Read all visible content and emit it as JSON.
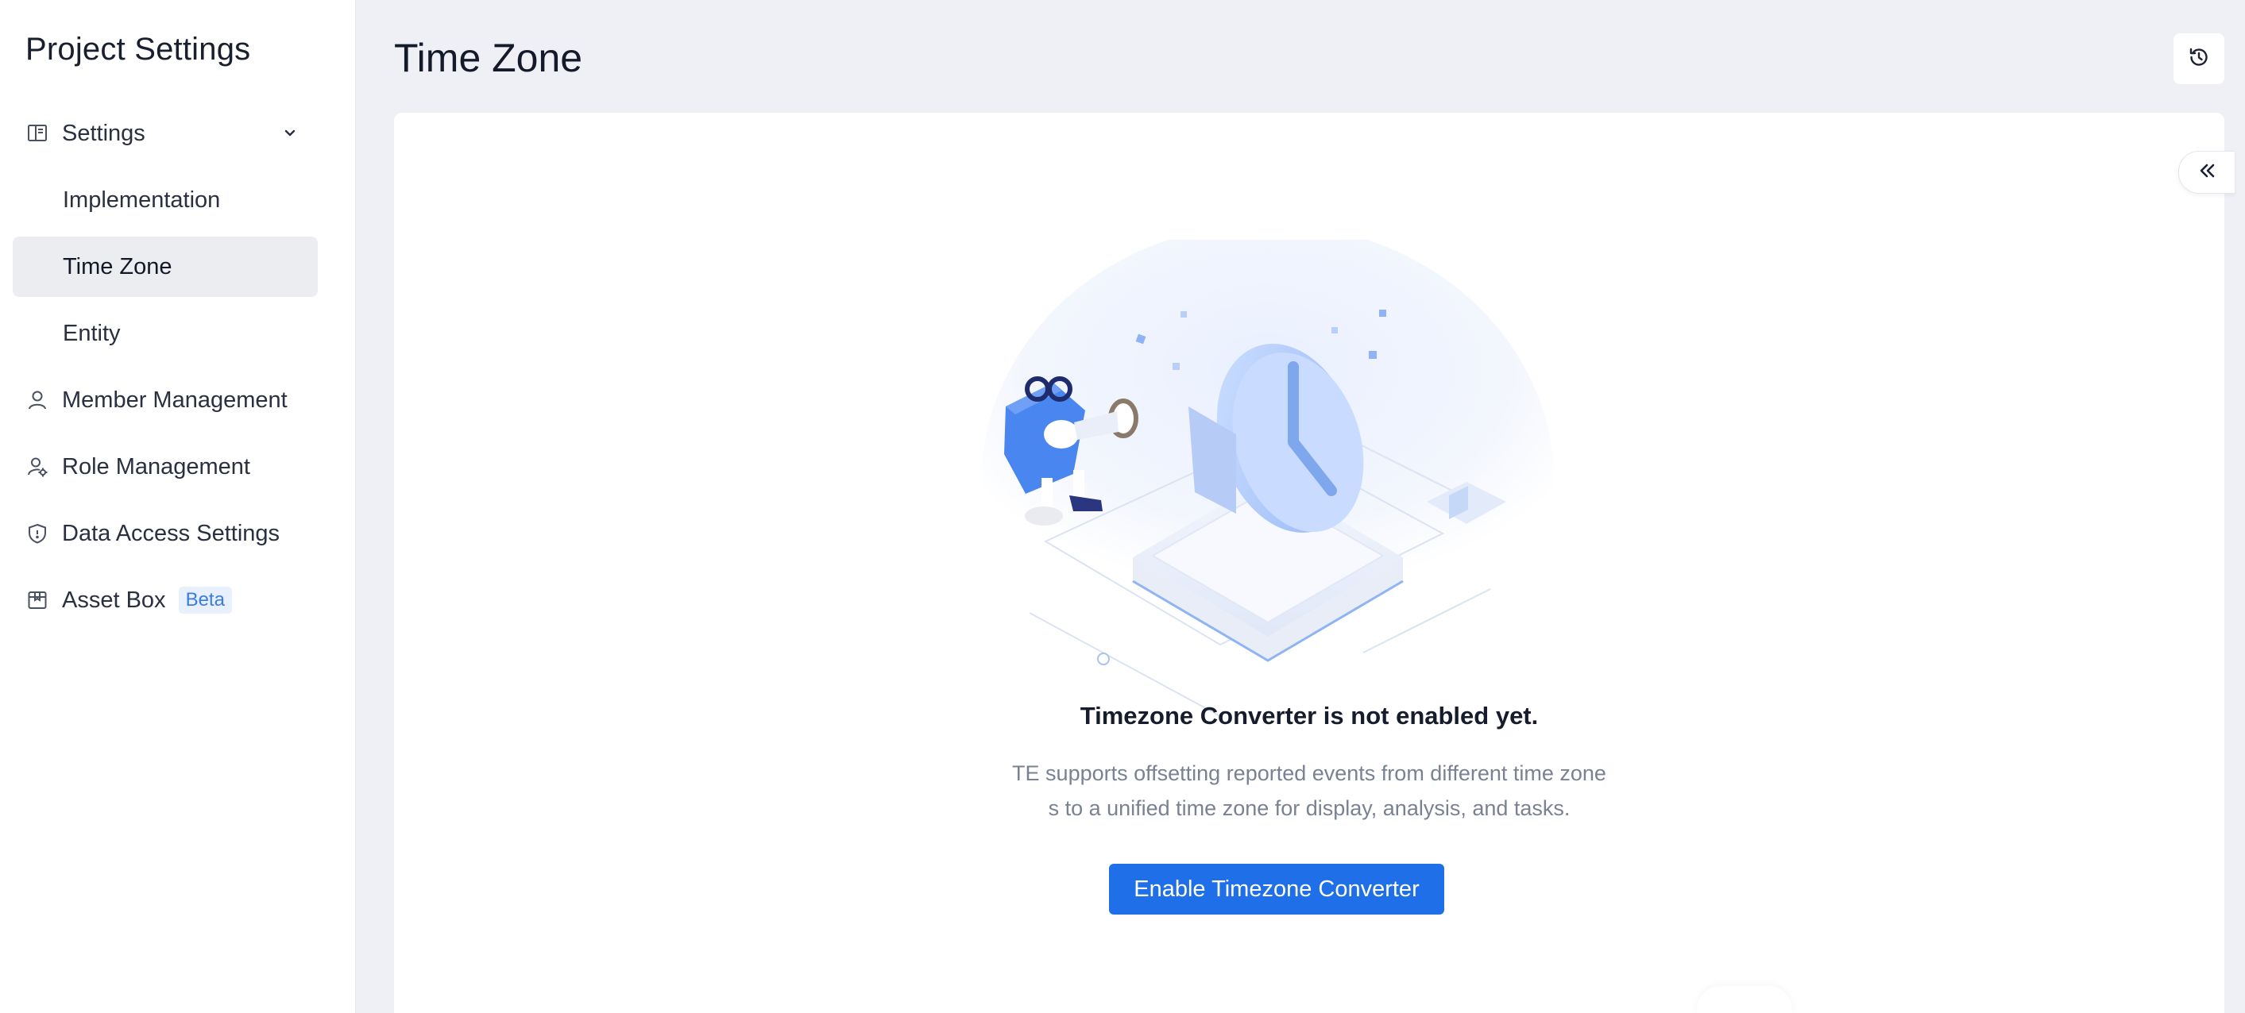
{
  "sidebar": {
    "title": "Project Settings",
    "items": [
      {
        "label": "Settings",
        "icon": "book-open-icon"
      },
      {
        "label": "Implementation"
      },
      {
        "label": "Time Zone"
      },
      {
        "label": "Entity"
      },
      {
        "label": "Member Management",
        "icon": "user-icon"
      },
      {
        "label": "Role Management",
        "icon": "user-gear-icon"
      },
      {
        "label": "Data Access Settings",
        "icon": "shield-icon"
      },
      {
        "label": "Asset Box",
        "icon": "box-icon",
        "badge": "Beta"
      }
    ],
    "active_item": "Time Zone"
  },
  "header": {
    "title": "Time Zone",
    "history_icon": "history-icon"
  },
  "empty_state": {
    "title": "Timezone Converter is not enabled yet.",
    "description_line1": "TE supports offsetting reported events from different time zone",
    "description_line2": "s to a unified time zone for display, analysis, and tasks.",
    "button_label": "Enable Timezone Converter"
  },
  "colors": {
    "accent": "#1f6fe8",
    "badge_bg": "#e8f0fe",
    "badge_text": "#3b7be8",
    "page_bg": "#eef0f5",
    "active_item_bg": "#ecedf1"
  }
}
